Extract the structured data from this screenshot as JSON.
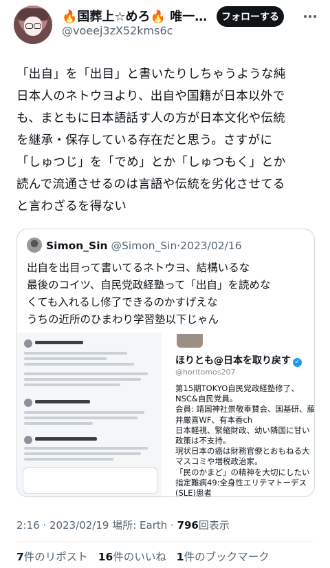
{
  "author": {
    "display_name": "🔥国葬上☆めろ🔥 唯一…",
    "handle": "@voeej3zX52kms6c",
    "follow_label": "フォローする"
  },
  "tweet": {
    "lines": [
      "「出自」を「出目」と書いたりしちゃうような純",
      "日本人のネトウヨより、出自や国籍が日本以外で",
      "も、まともに日本語話す人の方が日本文化や伝統",
      "を継承・保存している存在だと思う。さすがに",
      "「しゅつじ」を「でめ」とか「しゅつもく」とか",
      "読んで流通させるのは言語や伝統を劣化させてる",
      "と言わざるを得ない"
    ]
  },
  "quote": {
    "name": "Simon_Sin",
    "handle": "@Simon_Sin",
    "date": "·2023/02/16",
    "lines": [
      "出自を出目って書いてるネトウヨ、結構いるな",
      "最後のコイツ、自民党政経塾って「出自」を読めな",
      "くても入れるし修了できるのかすげえな",
      "うちの近所のひまわり学習塾以下じゃん"
    ],
    "profile": {
      "name": "ほりとも@日本を取り戻す",
      "handle": "@horitomos207",
      "bio_lines": [
        "第15期TOKYO自民党政経塾修了、",
        "NSC&自民党員。",
        "会員: 靖国神社崇敬奉賛会、国基研、藤",
        "井厳喜WF、有本香ch",
        "日本軽視、緊縮財政、幼い隣国に甘い",
        "政策は不支持。",
        "現状日本の癌は財務官僚とおもねる大",
        "マスコミや増税政治家。",
        "「民のかまど」の精神を大切にしたい",
        "指定難病49:全身性エリテマトーデス",
        "(SLE)患者"
      ]
    }
  },
  "meta": {
    "time": "2:16 · 2023/02/19 場所: Earth · ",
    "views_count": "796",
    "views_label": "回表示"
  },
  "stats": {
    "retweets_count": "7",
    "retweets_label": "件のリポスト",
    "likes_count": "16",
    "likes_label": "件のいいね",
    "bookmarks_count": "1",
    "bookmarks_label": "件のブックマーク"
  }
}
